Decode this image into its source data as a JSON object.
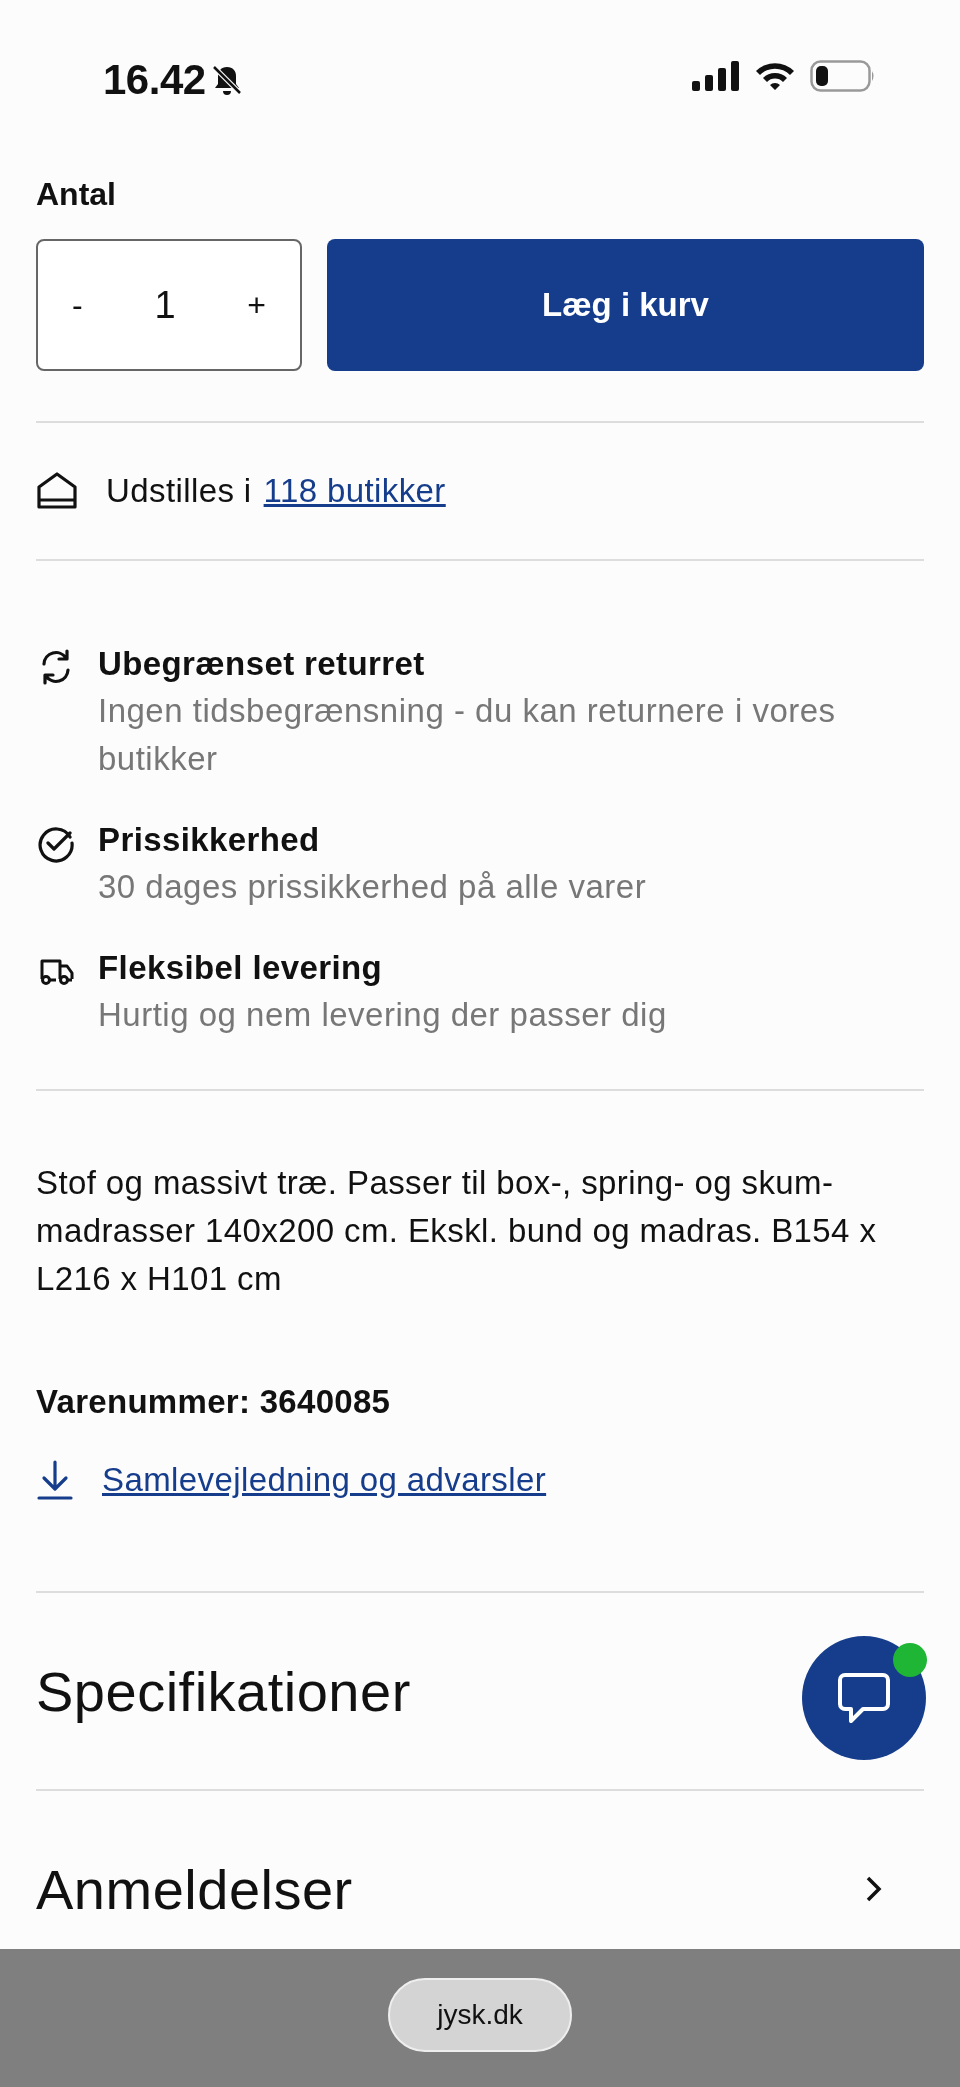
{
  "status_bar": {
    "time": "16.42",
    "muted": true
  },
  "quantity": {
    "label": "Antal",
    "decrement": "-",
    "value": "1",
    "increment": "+"
  },
  "add_to_cart_button": "Læg i kurv",
  "display": {
    "text": "Udstilles i",
    "link": "118 butikker"
  },
  "benefits": [
    {
      "kind": "returns",
      "title": "Ubegrænset returret",
      "description": "Ingen tidsbegrænsning - du kan returnere i vores butikker"
    },
    {
      "kind": "price",
      "title": "Prissikkerhed",
      "description": "30 dages prissikkerhed på alle varer"
    },
    {
      "kind": "delivery",
      "title": "Fleksibel levering",
      "description": "Hurtig og nem levering der passer dig"
    }
  ],
  "description": "Stof og massivt træ. Passer til box-, spring- og skum-madrasser 140x200 cm. Ekskl. bund og madras. B154 x L216 x H101 cm",
  "item_number": "Varenummer: 3640085",
  "download_link": "Samlevejledning og advarsler",
  "sections": [
    {
      "title": "Specifikationer"
    },
    {
      "title": "Anmeldelser",
      "chevron": true
    }
  ],
  "chat": {
    "online": true
  },
  "browser_bar": {
    "url": "jysk.dk"
  }
}
